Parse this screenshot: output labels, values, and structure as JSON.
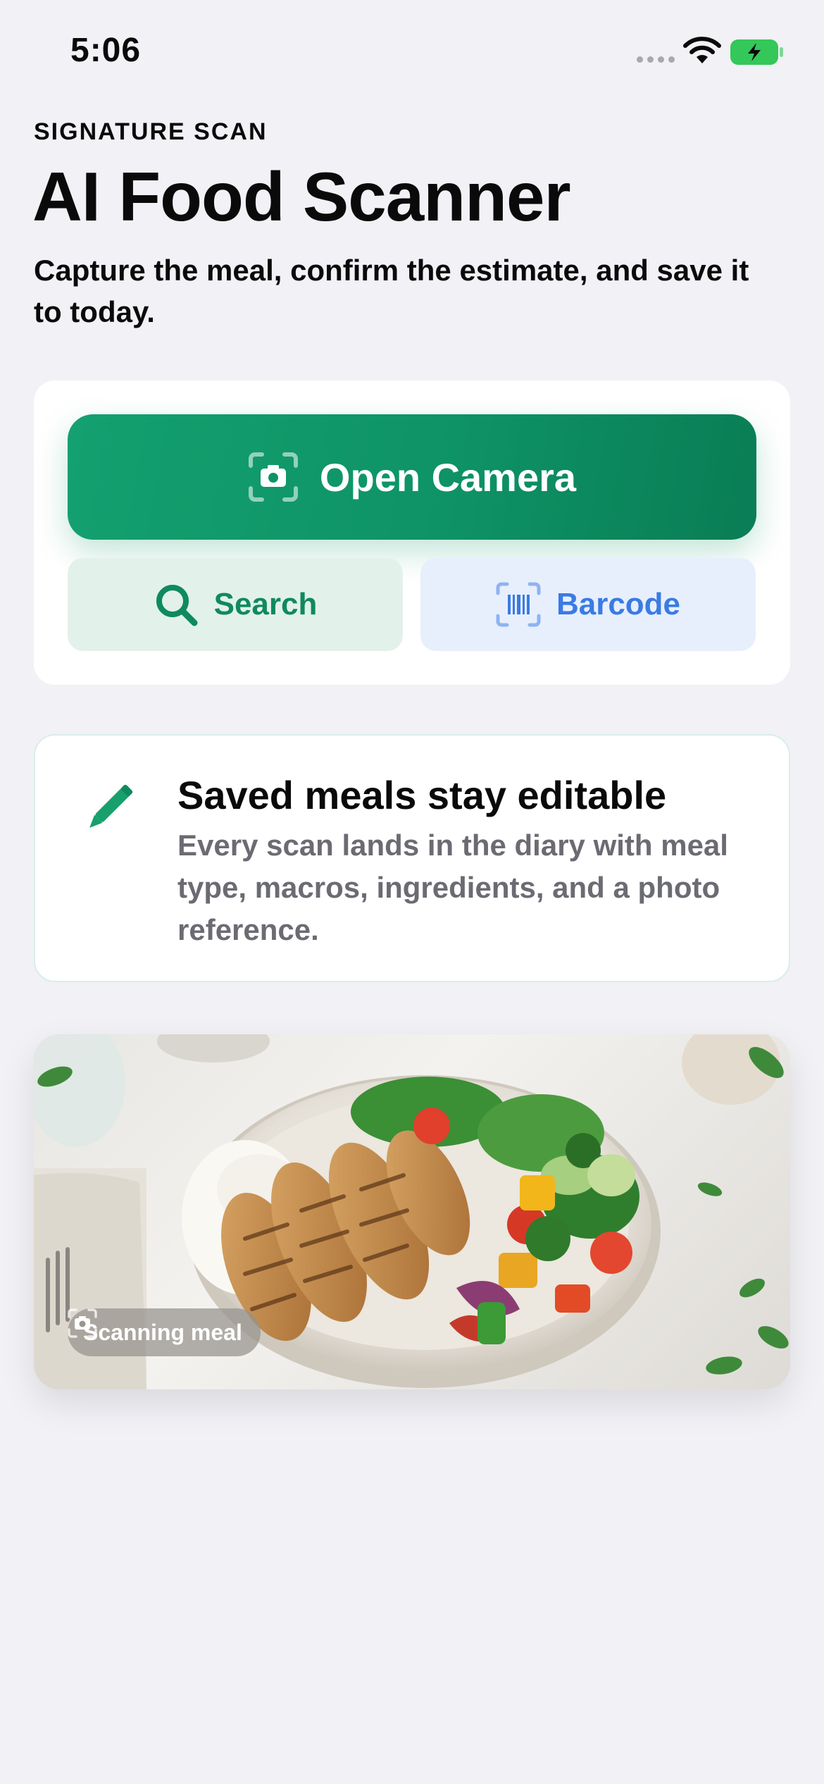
{
  "status_bar": {
    "time": "5:06",
    "battery_color": "#34c759"
  },
  "header": {
    "eyebrow": "SIGNATURE SCAN",
    "title": "AI Food Scanner",
    "subtitle": "Capture the meal, confirm the estimate, and save it to today."
  },
  "actions": {
    "camera_label": "Open Camera",
    "camera_icon": "camera-scan-icon",
    "search_label": "Search",
    "search_icon": "search-icon",
    "barcode_label": "Barcode",
    "barcode_icon": "barcode-icon",
    "primary_color": "#0e9366",
    "barcode_color": "#3a7be4"
  },
  "info_card": {
    "icon": "pencil-icon",
    "title": "Saved meals stay editable",
    "body": "Every scan lands in the diary with meal type, macros, ingredients, and a photo reference."
  },
  "photo": {
    "badge_label": "Scanning meal",
    "badge_icon": "camera-scan-icon"
  }
}
